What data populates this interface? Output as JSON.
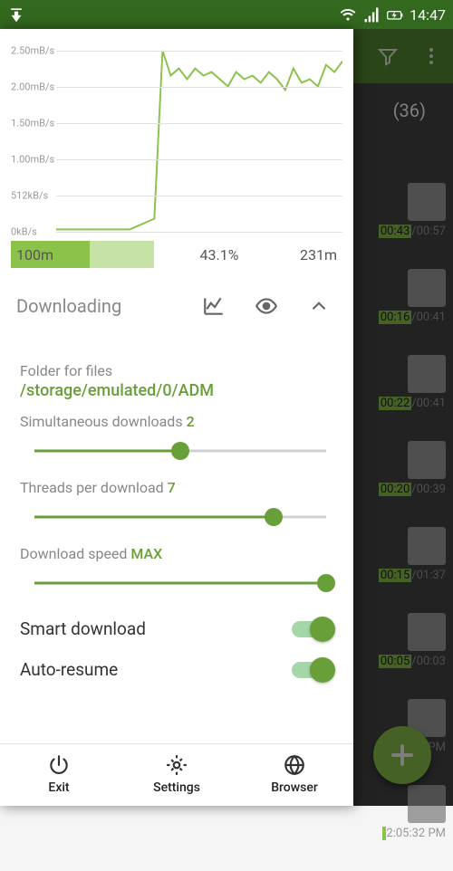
{
  "status": {
    "time": "14:47"
  },
  "background": {
    "count_badge": "(36)",
    "items": [
      {
        "time_a": "00:43",
        "time_b": "/00:57",
        "thumb": "zip"
      },
      {
        "time_a": "00:16",
        "time_b": "/00:41",
        "thumb": "video"
      },
      {
        "time_a": "00:22",
        "time_b": "/00:41",
        "thumb": "video"
      },
      {
        "time_a": "00:20",
        "time_b": "/00:39",
        "thumb": "video"
      },
      {
        "time_a": "00:15",
        "time_b": "/01:37",
        "thumb": "monitor"
      },
      {
        "time_a": "00:05",
        "time_b": "/00:03",
        "thumb": "music"
      },
      {
        "time_a": "",
        "time_b": "2:05:32 PM",
        "thumb": "image"
      },
      {
        "time_a": "",
        "time_b": "2:05:32 PM",
        "thumb": "image"
      }
    ]
  },
  "chart_data": {
    "type": "line",
    "ylabel_ticks": [
      "2.50mB/s",
      "2.00mB/s",
      "1.50mB/s",
      "1.00mB/s",
      "512kB/s",
      "0kB/s"
    ],
    "ylim": [
      0,
      2.5
    ],
    "series": [
      {
        "name": "speed",
        "values": [
          0,
          0,
          0,
          0,
          0,
          0,
          0,
          0,
          0,
          0,
          0.05,
          0.1,
          0.15,
          2.5,
          2.15,
          2.25,
          2.1,
          2.25,
          2.15,
          2.2,
          2.1,
          2.0,
          2.2,
          2.1,
          2.15,
          2.05,
          2.2,
          2.1,
          1.95,
          2.25,
          2.05,
          2.1,
          2.0,
          2.3,
          2.2,
          2.35
        ]
      }
    ]
  },
  "progress": {
    "left": "100m",
    "percent": "43.1%",
    "right": "231m"
  },
  "panel": {
    "title": "Downloading",
    "folder_label": "Folder for files",
    "folder_path": "/storage/emulated/0/ADM",
    "simul_label": "Simultaneous downloads ",
    "simul_val": "2",
    "simul_pct": 50,
    "threads_label": "Threads per download ",
    "threads_val": "7",
    "threads_pct": 82,
    "speed_label": "Download speed ",
    "speed_val": "MAX",
    "speed_pct": 100,
    "smart_label": "Smart download",
    "auto_label": "Auto-resume"
  },
  "bottom": {
    "exit": "Exit",
    "settings": "Settings",
    "browser": "Browser"
  }
}
